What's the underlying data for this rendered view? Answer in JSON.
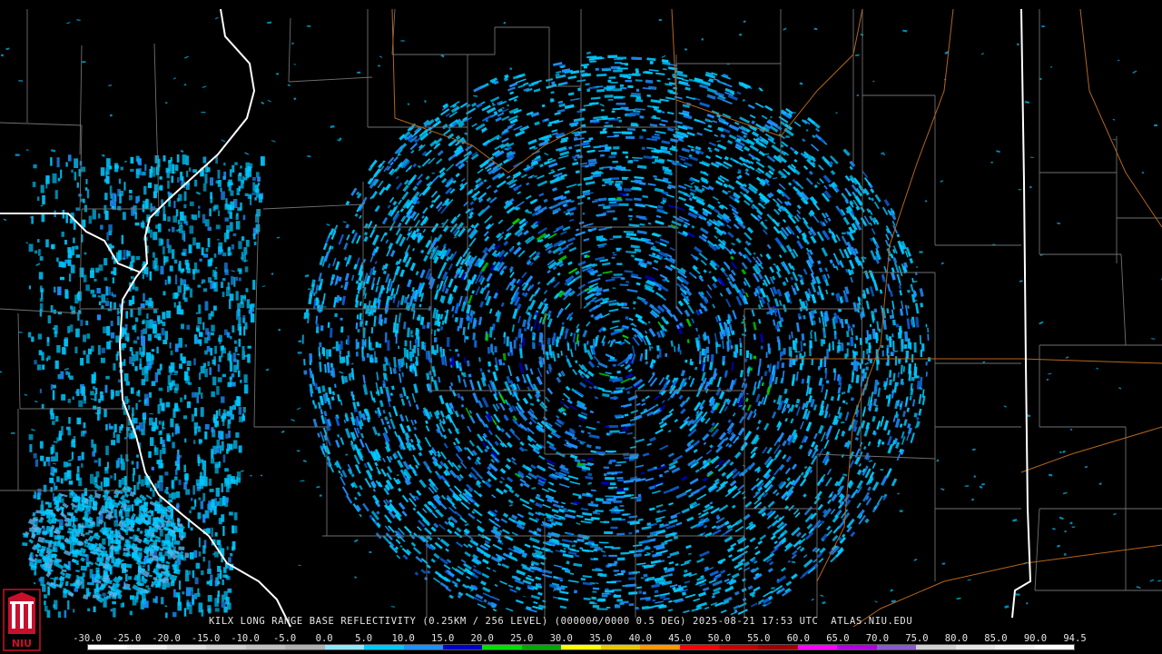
{
  "caption": {
    "site": "KILX",
    "product": "LONG RANGE BASE REFLECTIVITY",
    "resolution": "(0.25KM / 256 LEVEL)",
    "volume": "(000000/0000 0.5 DEG)",
    "datetime": "2025-08-21 17:53 UTC",
    "source": "ATLAS.NIU.EDU"
  },
  "colorbar": {
    "ticks": [
      "-30.0",
      "-25.0",
      "-20.0",
      "-15.0",
      "-10.0",
      "-5.0",
      "0.0",
      "5.0",
      "10.0",
      "15.0",
      "20.0",
      "25.0",
      "30.0",
      "35.0",
      "40.0",
      "45.0",
      "50.0",
      "55.0",
      "60.0",
      "65.0",
      "70.0",
      "75.0",
      "80.0",
      "85.0",
      "90.0",
      "94.5"
    ],
    "colors": [
      "#ffffff",
      "#f0f0f0",
      "#e0e0e0",
      "#d0d0d0",
      "#c0c0c0",
      "#b0b0b0",
      "#8fe6ff",
      "#00c8ff",
      "#1e90ff",
      "#0000c8",
      "#00e000",
      "#00a800",
      "#ffff00",
      "#e6c800",
      "#ff9600",
      "#ff0000",
      "#c80000",
      "#a00000",
      "#ff00ff",
      "#b000e0",
      "#8a5acd",
      "#d0d0d0",
      "#e6e6e6",
      "#f2f2f2",
      "#ffffff"
    ]
  },
  "map": {
    "radar_site": "KILX",
    "state_border_color": "#ffffff",
    "county_border_color": "#707070",
    "highway_color": "#b5651d",
    "echo_colors": [
      "#00c8ff",
      "#1e90ff",
      "#0a64dc",
      "#0000c8",
      "#00d000"
    ]
  },
  "logo": {
    "text": "NIU",
    "color": "#c8102e"
  }
}
